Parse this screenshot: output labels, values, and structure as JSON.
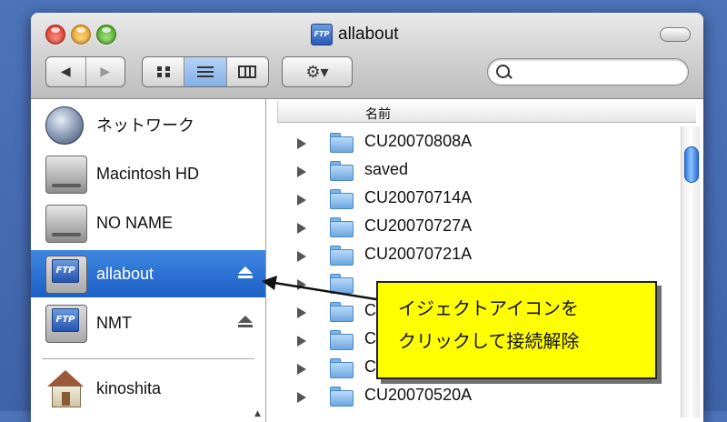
{
  "window": {
    "title": "allabout",
    "title_icon": "ftp-icon",
    "title_icon_label": "FTP"
  },
  "toolbar": {
    "back_icon": "◀",
    "forward_icon": "▶",
    "icon_view_glyph": "▪▪",
    "list_view_glyph": "☰",
    "column_view_glyph": "▥",
    "action_glyph": "⚙▾"
  },
  "sidebar": {
    "items": [
      {
        "label": "ネットワーク",
        "icon": "network-globe-icon"
      },
      {
        "label": "Macintosh HD",
        "icon": "hard-disk-icon"
      },
      {
        "label": "NO NAME",
        "icon": "hard-disk-icon"
      },
      {
        "label": "allabout",
        "icon": "ftp-volume-icon",
        "badge": "FTP",
        "selected": true,
        "eject": true
      },
      {
        "label": "NMT",
        "icon": "ftp-volume-icon",
        "badge": "FTP",
        "eject": true
      },
      {
        "label": "kinoshita",
        "icon": "home-icon"
      }
    ]
  },
  "content": {
    "column_header": "名前",
    "files": [
      "CU20070808A",
      "saved",
      "CU20070714A",
      "CU20070727A",
      "CU20070721A",
      "CU20070520A"
    ],
    "partially_hidden_rows": [
      {
        "prefix": "C"
      },
      {
        "prefix": "C"
      },
      {
        "prefix": "C"
      }
    ]
  },
  "callout": {
    "line1": "イジェクトアイコンを",
    "line2": "クリックして接続解除",
    "color": "#ffff00"
  },
  "colors": {
    "desktop": "#4d73ba",
    "selection": "#1c5fc7"
  }
}
